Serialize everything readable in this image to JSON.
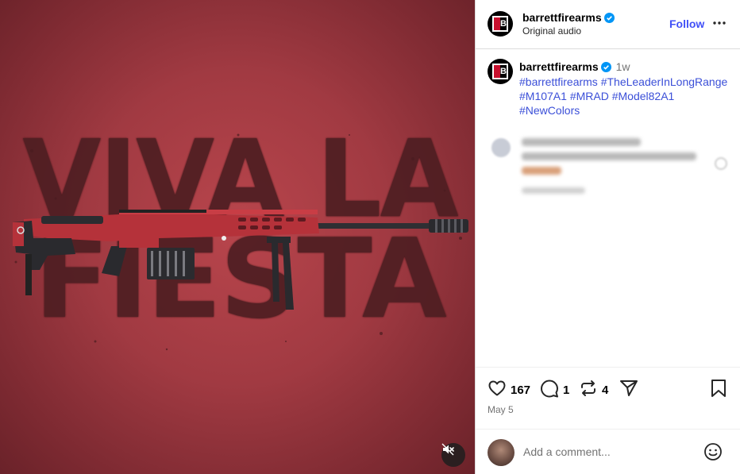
{
  "post": {
    "media": {
      "headline_line1": "VIVA LA",
      "headline_line2": "FIESTA",
      "mute_icon": "speaker-muted-icon"
    },
    "header": {
      "username": "barrettfirearms",
      "subtitle": "Original audio",
      "follow_label": "Follow",
      "more_icon": "more-icon",
      "logo_letter": "B"
    },
    "caption": {
      "username": "barrettfirearms",
      "time": "1w",
      "hashtags": "#barrettfirearms #TheLeaderInLongRange #M107A1 #MRAD #Model82A1 #NewColors"
    },
    "actions": {
      "likes": "167",
      "comments": "1",
      "reposts": "4"
    },
    "date": "May 5",
    "add_comment": {
      "placeholder": "Add a comment..."
    }
  },
  "colors": {
    "accent": "#4150f7",
    "link": "#3b4fd8",
    "media_red": "#a13a42",
    "verified": "#0095f6"
  }
}
